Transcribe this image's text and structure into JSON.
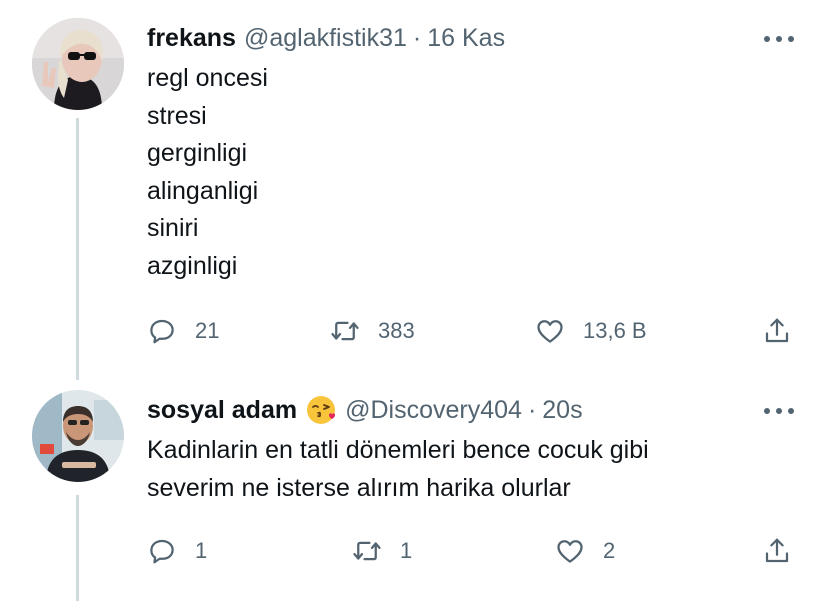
{
  "tweets": [
    {
      "name": "frekans",
      "handle": "@aglakfistik31",
      "separator": "·",
      "time": "16 Kas",
      "lines": [
        "regl oncesi",
        "stresi",
        "gerginligi",
        "alinganligi",
        "siniri",
        "azginligi"
      ],
      "replies": "21",
      "retweets": "383",
      "likes": "13,6 B"
    },
    {
      "name": "sosyal adam",
      "emoji": "face-blowing-kiss-emoji",
      "handle": "@Discovery404",
      "separator": "·",
      "time": "20s",
      "lines": [
        "Kadinlarin en tatli dönemleri bence cocuk gibi",
        "severim ne isterse alırım harika olurlar"
      ],
      "replies": "1",
      "retweets": "1",
      "likes": "2"
    }
  ],
  "icons": {
    "reply": "reply-icon",
    "retweet": "retweet-icon",
    "like": "heart-icon",
    "share": "share-icon",
    "more": "more-icon"
  },
  "colors": {
    "text": "#0f1419",
    "secondary": "#536471",
    "thread_line": "#cfd9de"
  }
}
